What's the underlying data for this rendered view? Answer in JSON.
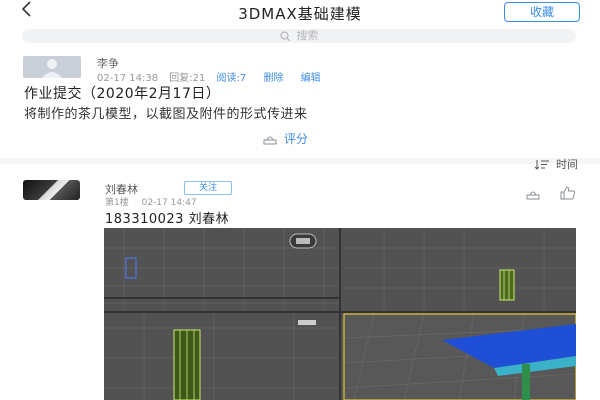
{
  "header": {
    "back_icon": "chevron-left-icon",
    "title": "3DMAX基础建模",
    "collect_label": "收藏"
  },
  "search": {
    "placeholder": "搜索",
    "icon": "search-icon"
  },
  "post": {
    "author": "李争",
    "time": "02-17 14:38",
    "reply_count": "回复:21",
    "read_count": "阅读:7",
    "delete_label": "删除",
    "edit_label": "编辑",
    "title": "作业提交（2020年2月17日）",
    "body": "将制作的茶几模型，以截图及附件的形式传进来",
    "rate_label": "评分"
  },
  "sort": {
    "label": "时间",
    "icon": "sort-icon"
  },
  "reply": {
    "author": "刘春林",
    "follow_label": "关注",
    "floor": "第1楼",
    "time": "02-17 14:47",
    "text": "183310023 刘春林",
    "icons": [
      "rate-icon",
      "thumbs-up-icon"
    ]
  },
  "colors": {
    "accent": "#3d8ce6",
    "viewport_bg": "#505050",
    "table_top": "#1f4fd6",
    "table_leg": "#c8e87a"
  }
}
